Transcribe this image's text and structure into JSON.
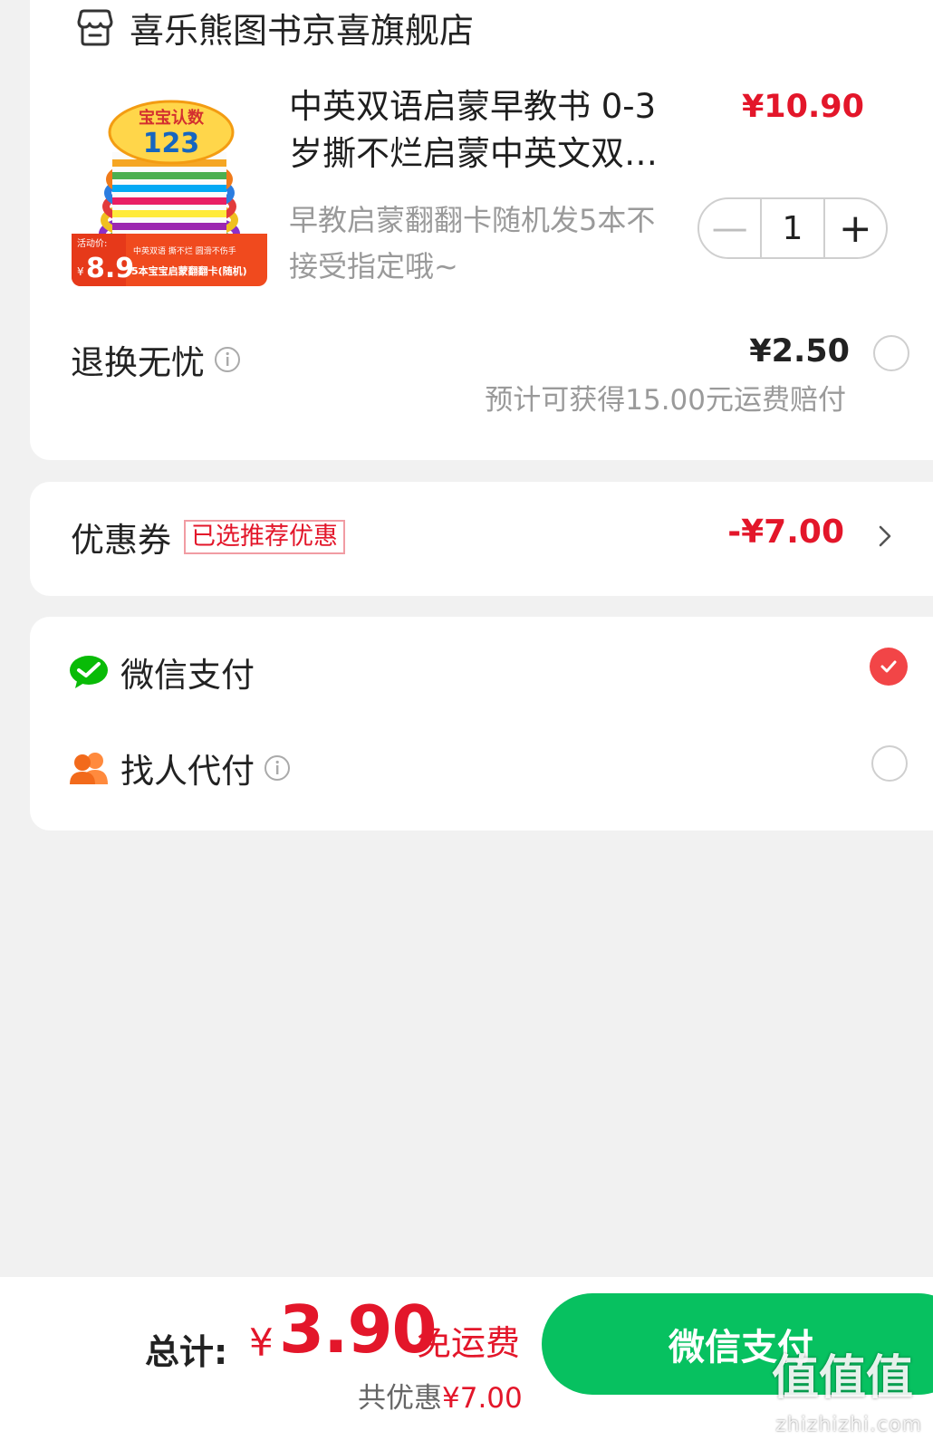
{
  "store": {
    "name": "喜乐熊图书京喜旗舰店"
  },
  "product": {
    "title": "中英双语启蒙早教书 0-3岁撕不烂启蒙中英文双…",
    "price": "¥10.90",
    "note": "早教启蒙翻翻卡随机发5本不接受指定哦~",
    "quantity": "1",
    "thumb": {
      "badge_top": "宝宝认数",
      "badge_num": "123",
      "promo_label": "活动价:",
      "promo_price": "8.9",
      "promo_yen": "¥",
      "promo_line1": "中英双语 撕不烂 圆滑不伤手",
      "promo_line2": "5本宝宝启蒙翻翻卡(随机)"
    }
  },
  "insurance": {
    "label": "退换无忧",
    "price": "¥2.50",
    "note": "预计可获得15.00元运费赔付"
  },
  "coupon": {
    "label": "优惠券",
    "tag": "已选推荐优惠",
    "value": "-¥7.00"
  },
  "payment": {
    "options": [
      {
        "label": "微信支付",
        "selected": true
      },
      {
        "label": "找人代付",
        "selected": false
      }
    ]
  },
  "footer": {
    "total_label": "总计:",
    "currency": "¥",
    "total": "3.90",
    "shipping": "免运费",
    "saved_prefix": "共优惠",
    "saved_value": "¥7.00",
    "pay_button": "微信支付"
  },
  "watermark": {
    "text": "值值值",
    "domain": "zhizhizhi.com"
  },
  "colors": {
    "accent": "#e3162a",
    "wechat_green": "#07c160",
    "check_red": "#f24547"
  }
}
